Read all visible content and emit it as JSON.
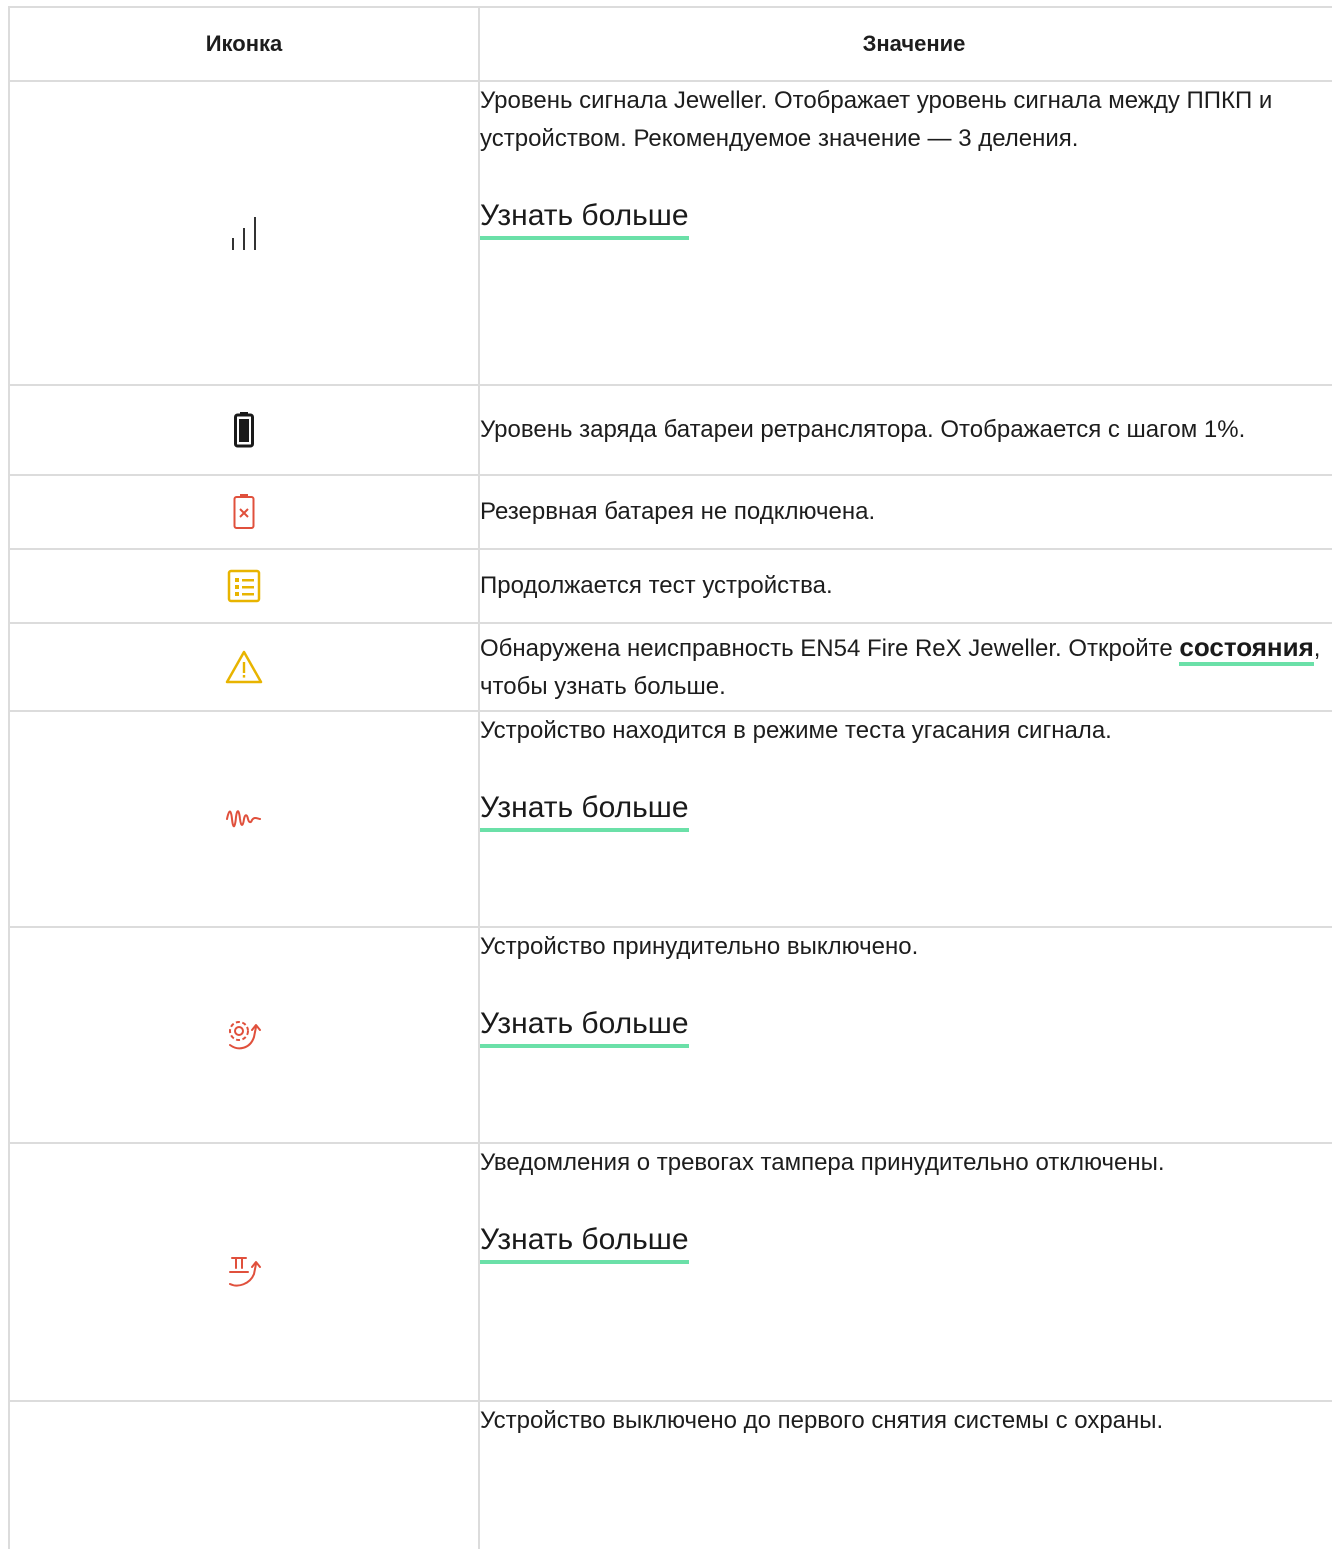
{
  "table": {
    "header": {
      "icon_col": "Иконка",
      "meaning_col": "Значение"
    },
    "more_label": "Узнать больше",
    "rows": [
      {
        "icon": "signal-strength-icon",
        "text": "Уровень сигнала Jeweller. Отображает уровень сигнала между ППКП и устройством. Рекомендуемое значение — 3 деления."
      },
      {
        "icon": "battery-icon",
        "text": "Уровень заряда батареи ретранслятора. Отображается с шагом 1%."
      },
      {
        "icon": "battery-disconnected-icon",
        "text": "Резервная батарея не подключена."
      },
      {
        "icon": "test-checklist-icon",
        "text": "Продолжается тест устройства."
      },
      {
        "icon": "warning-triangle-icon",
        "text_before": "Обнаружена неисправность EN54 Fire ReX Jeweller. Откройте ",
        "link": "состояния",
        "text_after": ", чтобы узнать больше."
      },
      {
        "icon": "signal-attenuation-icon",
        "text": "Устройство находится в режиме теста угасания сигнала."
      },
      {
        "icon": "gear-disabled-icon",
        "text": "Устройство принудительно выключено."
      },
      {
        "icon": "tamper-disabled-icon",
        "text": "Уведомления о тревогах тампера принудительно отключены."
      },
      {
        "icon": "disarm-disabled-icon",
        "text": "Устройство выключено до первого снятия системы с охраны."
      }
    ]
  },
  "colors": {
    "border": "#dcdcdc",
    "link_underline": "#6be0a8",
    "red": "#e0503c",
    "amber": "#e8b400"
  }
}
